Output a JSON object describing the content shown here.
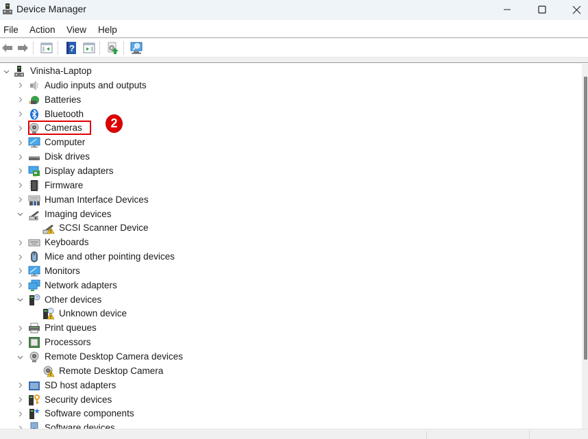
{
  "window": {
    "title": "Device Manager",
    "controls": {
      "minimize": "minimize",
      "maximize": "maximize",
      "close": "close"
    }
  },
  "menubar": {
    "items": [
      "File",
      "Action",
      "View",
      "Help"
    ]
  },
  "toolbar": {
    "buttons": [
      {
        "name": "back",
        "icon": "arrow-left-icon",
        "enabled": false
      },
      {
        "name": "forward",
        "icon": "arrow-right-icon",
        "enabled": false
      },
      {
        "name": "show-hide-console-tree",
        "icon": "console-tree-icon"
      },
      {
        "name": "help",
        "icon": "help-icon"
      },
      {
        "name": "show-hide-action-pane",
        "icon": "action-pane-icon"
      },
      {
        "name": "update-driver",
        "icon": "update-driver-icon"
      },
      {
        "name": "scan-hardware-changes",
        "icon": "scan-hardware-icon"
      }
    ]
  },
  "tree": {
    "root": {
      "label": "Vinisha-Laptop",
      "expanded": true,
      "icon": "computer-tower-icon"
    },
    "items": [
      {
        "label": "Audio inputs and outputs",
        "icon": "speaker-icon",
        "expanded": false,
        "level": 1
      },
      {
        "label": "Batteries",
        "icon": "battery-icon",
        "expanded": false,
        "level": 1
      },
      {
        "label": "Bluetooth",
        "icon": "bluetooth-icon",
        "expanded": false,
        "level": 1
      },
      {
        "label": "Cameras",
        "icon": "webcam-icon",
        "expanded": false,
        "level": 1,
        "highlighted": true
      },
      {
        "label": "Computer",
        "icon": "monitor-icon",
        "expanded": false,
        "level": 1
      },
      {
        "label": "Disk drives",
        "icon": "disk-drive-icon",
        "expanded": false,
        "level": 1
      },
      {
        "label": "Display adapters",
        "icon": "display-adapter-icon",
        "expanded": false,
        "level": 1
      },
      {
        "label": "Firmware",
        "icon": "firmware-chip-icon",
        "expanded": false,
        "level": 1
      },
      {
        "label": "Human Interface Devices",
        "icon": "hid-icon",
        "expanded": false,
        "level": 1
      },
      {
        "label": "Imaging devices",
        "icon": "scanner-icon",
        "expanded": true,
        "level": 1
      },
      {
        "label": "SCSI Scanner Device",
        "icon": "scanner-warning-icon",
        "level": 2
      },
      {
        "label": "Keyboards",
        "icon": "keyboard-icon",
        "expanded": false,
        "level": 1
      },
      {
        "label": "Mice and other pointing devices",
        "icon": "mouse-icon",
        "expanded": false,
        "level": 1
      },
      {
        "label": "Monitors",
        "icon": "monitor-icon",
        "expanded": false,
        "level": 1
      },
      {
        "label": "Network adapters",
        "icon": "network-adapter-icon",
        "expanded": false,
        "level": 1
      },
      {
        "label": "Other devices",
        "icon": "unknown-device-icon",
        "expanded": true,
        "level": 1
      },
      {
        "label": "Unknown device",
        "icon": "unknown-device-warning-icon",
        "level": 2
      },
      {
        "label": "Print queues",
        "icon": "printer-icon",
        "expanded": false,
        "level": 1
      },
      {
        "label": "Processors",
        "icon": "processor-icon",
        "expanded": false,
        "level": 1
      },
      {
        "label": "Remote Desktop Camera devices",
        "icon": "webcam-icon",
        "expanded": true,
        "level": 1
      },
      {
        "label": "Remote Desktop Camera",
        "icon": "webcam-warning-icon",
        "level": 2
      },
      {
        "label": "SD host adapters",
        "icon": "sd-card-icon",
        "expanded": false,
        "level": 1
      },
      {
        "label": "Security devices",
        "icon": "security-key-icon",
        "expanded": false,
        "level": 1
      },
      {
        "label": "Software components",
        "icon": "software-component-icon",
        "expanded": false,
        "level": 1
      },
      {
        "label": "Software devices",
        "icon": "software-device-icon",
        "expanded": false,
        "level": 1
      }
    ]
  },
  "annotation": {
    "step_number": "2",
    "target": "Cameras",
    "color": "#e00000"
  }
}
